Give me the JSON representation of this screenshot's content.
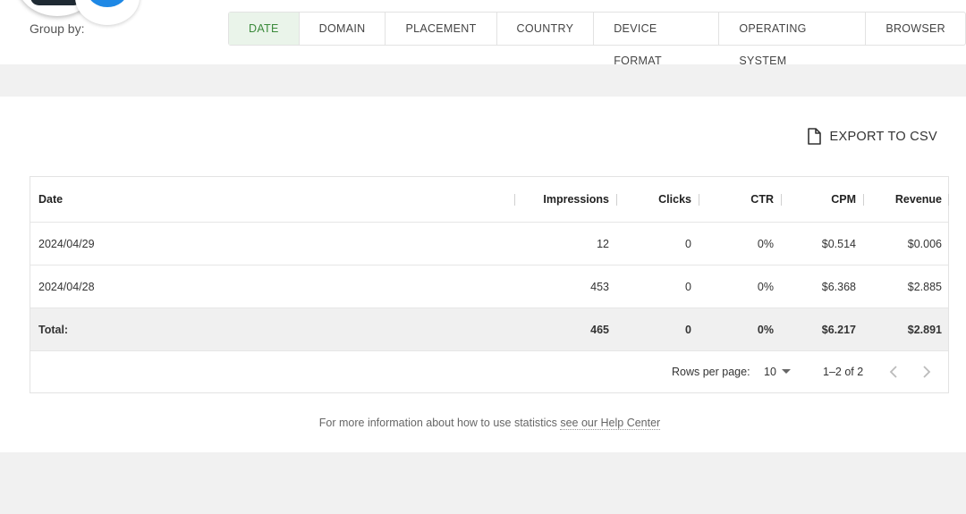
{
  "toolbar": {
    "group_by_label": "Group by:",
    "tabs": [
      {
        "label": "DATE",
        "active": true
      },
      {
        "label": "DOMAIN"
      },
      {
        "label": "PLACEMENT"
      },
      {
        "label": "COUNTRY"
      },
      {
        "label": "DEVICE FORMAT"
      },
      {
        "label": "OPERATING SYSTEM"
      },
      {
        "label": "BROWSER"
      }
    ]
  },
  "export": {
    "label": "EXPORT TO CSV",
    "icon": "file-icon"
  },
  "table": {
    "columns": [
      "Date",
      "Impressions",
      "Clicks",
      "CTR",
      "CPM",
      "Revenue"
    ],
    "rows": [
      {
        "date": "2024/04/29",
        "impressions": "12",
        "clicks": "0",
        "ctr": "0%",
        "cpm": "$0.514",
        "revenue": "$0.006"
      },
      {
        "date": "2024/04/28",
        "impressions": "453",
        "clicks": "0",
        "ctr": "0%",
        "cpm": "$6.368",
        "revenue": "$2.885"
      }
    ],
    "total": {
      "label": "Total:",
      "impressions": "465",
      "clicks": "0",
      "ctr": "0%",
      "cpm": "$6.217",
      "revenue": "$2.891"
    }
  },
  "pagination": {
    "rows_per_page_label": "Rows per page:",
    "rows_per_page_value": "10",
    "range_text": "1–2 of 2"
  },
  "help": {
    "text": "For more information about how to use statistics ",
    "link_text": "see our Help Center"
  },
  "colors": {
    "active_tab_bg": "#eaf4ea",
    "active_tab_text": "#3b8a3b",
    "messenger_blue": "#1e88e5"
  }
}
